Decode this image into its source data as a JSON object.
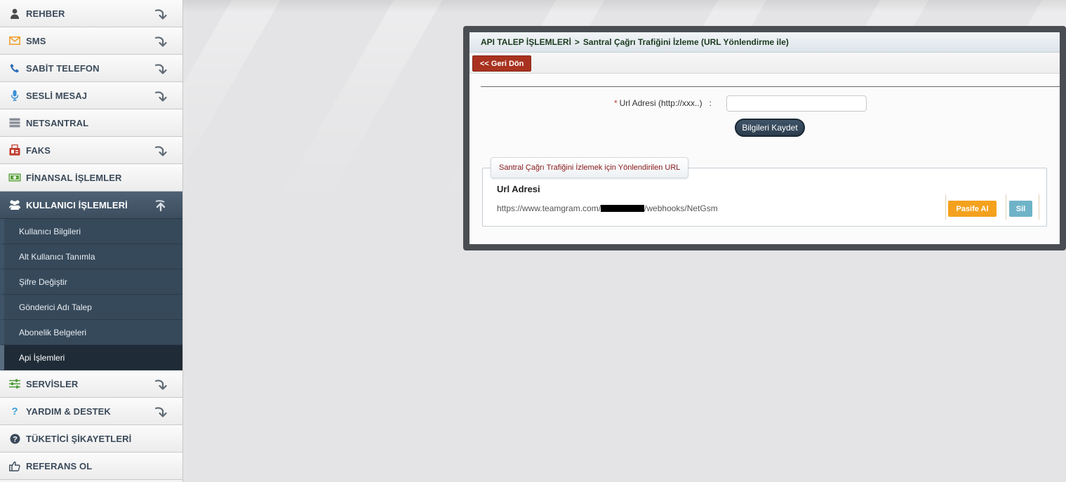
{
  "sidebar": {
    "items_top": [
      {
        "label": "REHBER",
        "icon": "user-icon",
        "icon_color": "#4a4a4a"
      },
      {
        "label": "SMS",
        "icon": "envelope-icon",
        "icon_color": "#f0a030"
      },
      {
        "label": "SABİT TELEFON",
        "icon": "phone-icon",
        "icon_color": "#2f6fb6"
      },
      {
        "label": "SESLİ MESAJ",
        "icon": "microphone-icon",
        "icon_color": "#3b8fd6"
      },
      {
        "label": "NETSANTRAL",
        "icon": "server-icon",
        "icon_color": "#8a8f98"
      },
      {
        "label": "FAKS",
        "icon": "fax-icon",
        "icon_color": "#c0392b"
      },
      {
        "label": "FİNANSAL İŞLEMLER",
        "icon": "money-icon",
        "icon_color": "#5aa03c"
      }
    ],
    "active_item": {
      "label": "KULLANICI İŞLEMLERİ",
      "icon": "users-icon"
    },
    "sub_items": [
      {
        "label": "Kullanıcı Bilgileri"
      },
      {
        "label": "Alt Kullanıcı Tanımla"
      },
      {
        "label": "Şifre Değiştir"
      },
      {
        "label": "Gönderici Adı Talep"
      },
      {
        "label": "Abonelik Belgeleri"
      },
      {
        "label": "Api İşlemleri"
      }
    ],
    "items_bottom": [
      {
        "label": "SERVİSLER",
        "icon": "sliders-icon",
        "icon_color": "#4e9a3a"
      },
      {
        "label": "YARDIM & DESTEK",
        "icon": "question-icon",
        "icon_color": "#3b9fd6"
      },
      {
        "label": "TÜKETİCİ ŞİKAYETLERİ",
        "icon": "question-circle-icon",
        "icon_color": "#3b4a5a"
      },
      {
        "label": "REFERANS OL",
        "icon": "thumbs-up-icon",
        "icon_color": "#3b4a5a"
      }
    ]
  },
  "panel": {
    "breadcrumb_root": "API TALEP İŞLEMLERİ",
    "breadcrumb_sep": ">",
    "breadcrumb_current": "Santral Çağrı Trafiğini İzleme (URL Yönlendirme ile)",
    "back_label": "<< Geri Dön",
    "form": {
      "required_mark": "*",
      "url_label": "Url Adresi (http://xxx..)",
      "colon": ":",
      "url_value": "",
      "save_label": "Bilgileri Kaydet"
    },
    "url_box": {
      "legend": "Santral Çağrı Trafiğini İzlemek için Yönlendirilen URL",
      "title": "Url Adresi",
      "url_prefix": "https://www.teamgram.com/",
      "url_suffix": "/webhooks/NetGsm",
      "passive_label": "Pasife Al",
      "delete_label": "Sil"
    }
  },
  "colors": {
    "active_menu": "#3c4d5e",
    "back_button": "#a8321f",
    "passive_button": "#f4a11e",
    "delete_button": "#6fb3c8"
  }
}
